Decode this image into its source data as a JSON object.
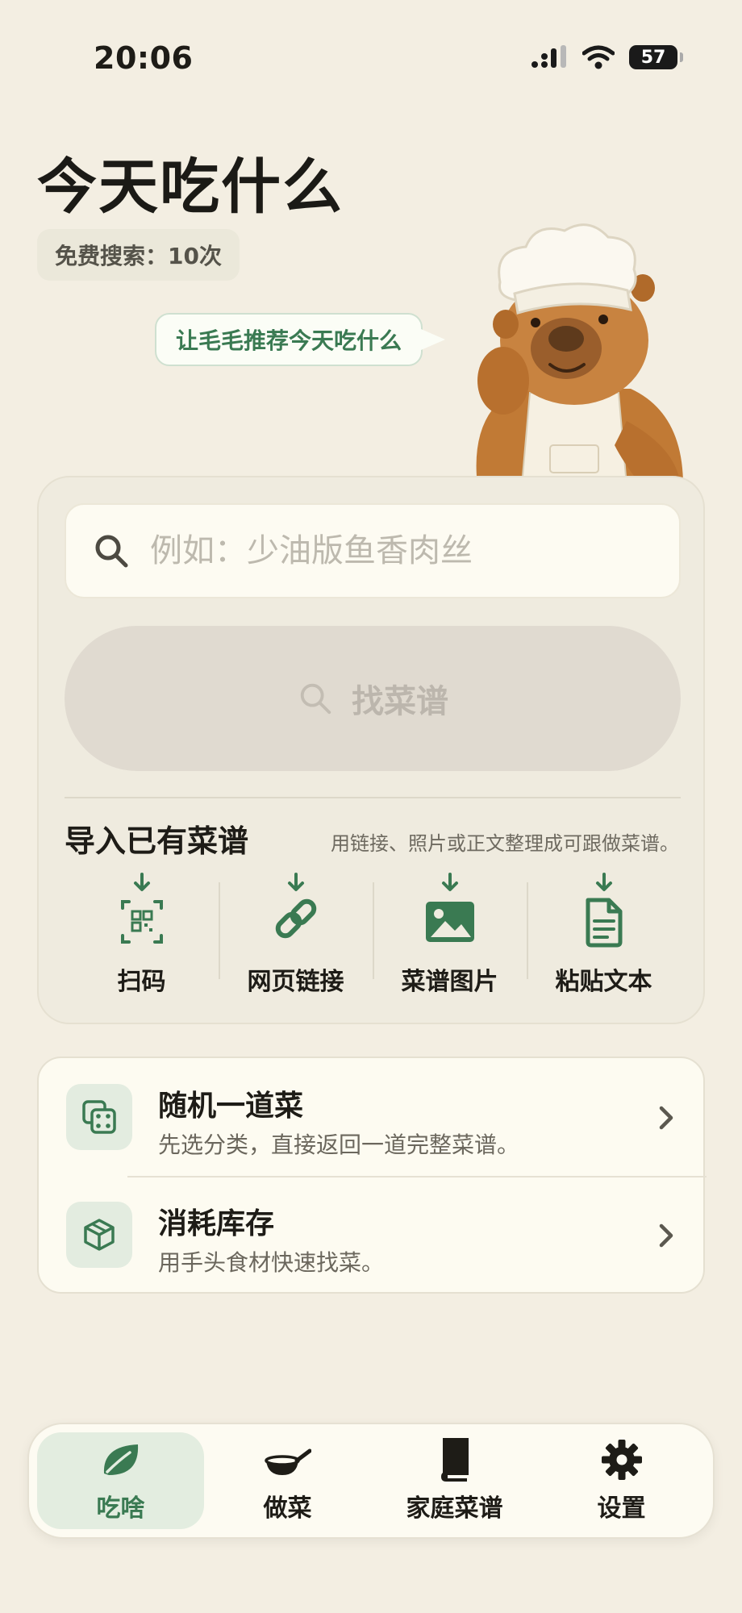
{
  "status_bar": {
    "time": "20:06",
    "battery": "57"
  },
  "header": {
    "title": "今天吃什么",
    "free_search": "免费搜索：10次",
    "bubble": "让毛毛推荐今天吃什么"
  },
  "search": {
    "placeholder": "例如：少油版鱼香肉丝",
    "value": "",
    "button_label": "找菜谱"
  },
  "import": {
    "title": "导入已有菜谱",
    "description": "用链接、照片或正文整理成可跟做菜谱。",
    "items": [
      {
        "label": "扫码",
        "icon": "qr-scan-icon"
      },
      {
        "label": "网页链接",
        "icon": "link-icon"
      },
      {
        "label": "菜谱图片",
        "icon": "image-icon"
      },
      {
        "label": "粘贴文本",
        "icon": "document-icon"
      }
    ]
  },
  "actions": [
    {
      "title": "随机一道菜",
      "subtitle": "先选分类，直接返回一道完整菜谱。",
      "icon": "dice-icon"
    },
    {
      "title": "消耗库存",
      "subtitle": "用手头食材快速找菜。",
      "icon": "box-icon"
    }
  ],
  "tabs": [
    {
      "label": "吃啥",
      "icon": "leaf-icon",
      "active": true
    },
    {
      "label": "做菜",
      "icon": "wok-icon",
      "active": false
    },
    {
      "label": "家庭菜谱",
      "icon": "book-icon",
      "active": false
    },
    {
      "label": "设置",
      "icon": "gear-icon",
      "active": false
    }
  ],
  "colors": {
    "accent": "#3a7a52",
    "background": "#f3eee2",
    "card": "#efebdf"
  }
}
